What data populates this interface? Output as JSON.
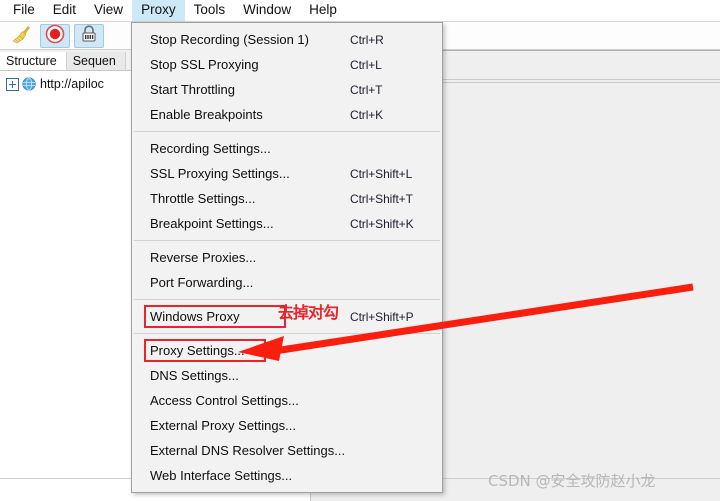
{
  "menubar": {
    "items": [
      {
        "label": "File",
        "active": false
      },
      {
        "label": "Edit",
        "active": false
      },
      {
        "label": "View",
        "active": false
      },
      {
        "label": "Proxy",
        "active": true
      },
      {
        "label": "Tools",
        "active": false
      },
      {
        "label": "Window",
        "active": false
      },
      {
        "label": "Help",
        "active": false
      }
    ]
  },
  "toolbar": {
    "buttons": [
      {
        "icon": "broom-icon",
        "toggled": false
      },
      {
        "icon": "record-icon",
        "toggled": true
      },
      {
        "icon": "ssl-lock-icon",
        "toggled": true
      }
    ]
  },
  "left_panel": {
    "tabs": [
      {
        "label": "Structure",
        "active": true
      },
      {
        "label": "Sequen",
        "active": false
      }
    ],
    "tree": [
      {
        "label": "http://apiloc",
        "icon": "globe-icon",
        "expander": "plus"
      }
    ]
  },
  "proxy_menu": {
    "items": [
      {
        "label": "Stop Recording (Session 1)",
        "shortcut": "Ctrl+R",
        "type": "item"
      },
      {
        "label": "Stop SSL Proxying",
        "shortcut": "Ctrl+L",
        "type": "item"
      },
      {
        "label": "Start Throttling",
        "shortcut": "Ctrl+T",
        "type": "item"
      },
      {
        "label": "Enable Breakpoints",
        "shortcut": "Ctrl+K",
        "type": "item"
      },
      {
        "type": "separator"
      },
      {
        "label": "Recording Settings...",
        "shortcut": "",
        "type": "item"
      },
      {
        "label": "SSL Proxying Settings...",
        "shortcut": "Ctrl+Shift+L",
        "type": "item"
      },
      {
        "label": "Throttle Settings...",
        "shortcut": "Ctrl+Shift+T",
        "type": "item"
      },
      {
        "label": "Breakpoint Settings...",
        "shortcut": "Ctrl+Shift+K",
        "type": "item"
      },
      {
        "type": "separator"
      },
      {
        "label": "Reverse Proxies...",
        "shortcut": "",
        "type": "item"
      },
      {
        "label": "Port Forwarding...",
        "shortcut": "",
        "type": "item"
      },
      {
        "type": "separator"
      },
      {
        "label": "Windows Proxy",
        "shortcut": "Ctrl+Shift+P",
        "type": "item",
        "highlight": "box-windows-proxy"
      },
      {
        "type": "separator"
      },
      {
        "label": "Proxy Settings...",
        "shortcut": "",
        "type": "item",
        "highlight": "box-proxy-settings"
      },
      {
        "label": "DNS Settings...",
        "shortcut": "",
        "type": "item"
      },
      {
        "label": "Access Control Settings...",
        "shortcut": "",
        "type": "item"
      },
      {
        "label": "External Proxy Settings...",
        "shortcut": "",
        "type": "item"
      },
      {
        "label": "External DNS Resolver Settings...",
        "shortcut": "",
        "type": "item"
      },
      {
        "label": "Web Interface Settings...",
        "shortcut": "",
        "type": "item"
      }
    ]
  },
  "annotations": {
    "note": "去掉对勾",
    "note_color": "#e8252a",
    "arrow_color": "#fa1e0e",
    "highlight_color": "#e8252a"
  },
  "watermark": {
    "text": "CSDN @安全攻防赵小龙"
  }
}
